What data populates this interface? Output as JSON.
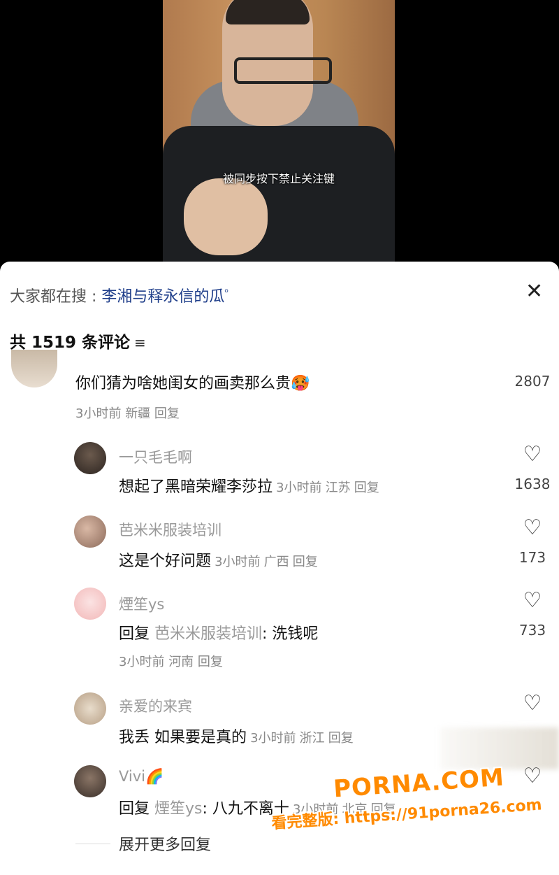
{
  "video": {
    "caption": "被同步按下禁止关注键"
  },
  "search": {
    "prefix": "大家都在搜 : ",
    "keyword": "李湘与释永信的瓜",
    "icon": "search-icon"
  },
  "header": {
    "count_label": "共 1519 条评论",
    "filter_icon": "≡"
  },
  "top_comment": {
    "text": "你们猜为啥她闺女的画卖那么贵",
    "emoji": "🥵",
    "time": "3小时前",
    "location": "新疆",
    "reply_label": "回复",
    "likes": "2807"
  },
  "replies": [
    {
      "name": "一只毛毛啊",
      "text": "想起了黑暗荣耀李莎拉",
      "time": "3小时前",
      "location": "江苏",
      "reply_label": "回复",
      "likes": "1638"
    },
    {
      "name": "芭米米服装培训",
      "text": "这是个好问题",
      "time": "3小时前",
      "location": "广西",
      "reply_label": "回复",
      "likes": "173"
    },
    {
      "name": "煙笙ys",
      "text_prefix": "回复 ",
      "quoted_user": "芭米米服装培训",
      "text": ": 洗钱呢",
      "time": "3小时前",
      "location": "河南",
      "reply_label": "回复",
      "likes": "733"
    },
    {
      "name": "亲爱的来宾",
      "text": "我丢 如果要是真的",
      "time": "3小时前",
      "location": "浙江",
      "reply_label": "回复"
    },
    {
      "name": "Vivi🌈",
      "text_prefix": "回复 ",
      "quoted_user": "煙笙ys",
      "text": ": 八九不离十",
      "time": "3小时前",
      "location": "北京",
      "reply_label": "回复"
    }
  ],
  "expand_label": "展开更多回复",
  "watermark": {
    "brand": "PORNA.COM",
    "line": "看完整版: https://91porna26.com"
  },
  "colors": {
    "keyword": "#1f3e8a",
    "watermark": "#ff8a00"
  }
}
